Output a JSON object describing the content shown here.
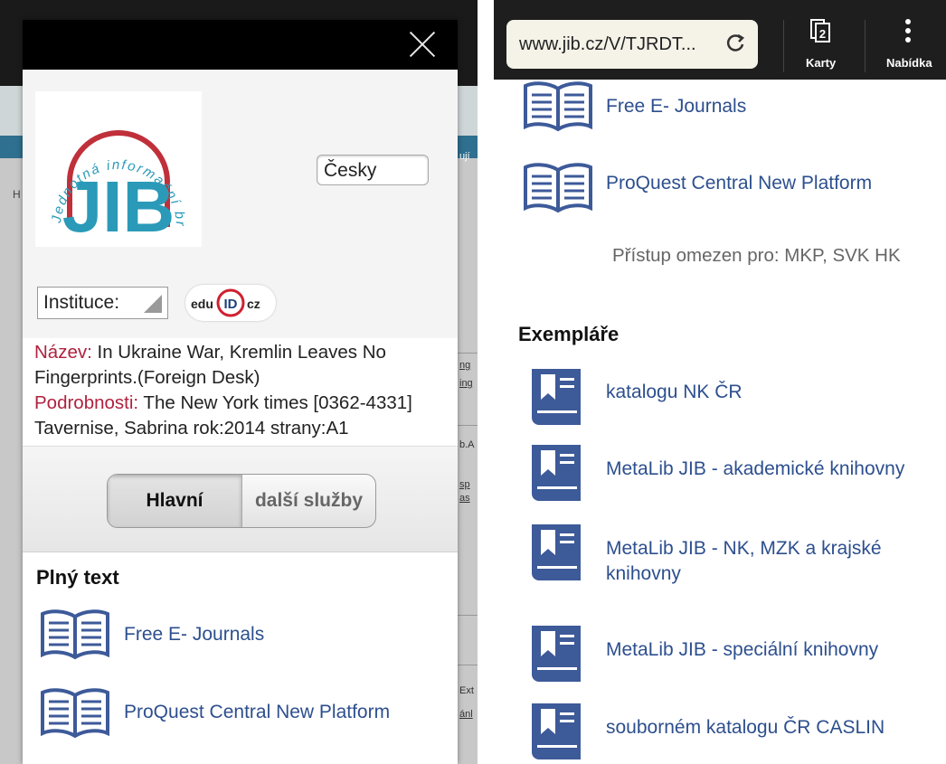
{
  "modal": {
    "logo_text": "JIB",
    "logo_arc_text": "Jednotná informační brána",
    "language_value": "Česky",
    "institution_label": "Instituce:",
    "eduid_logo": "eduID.cz",
    "record": {
      "title_label": "Název:",
      "title_value": " In Ukraine War, Kremlin Leaves No Fingerprints.(Foreign Desk)",
      "details_label": "Podrobnosti:",
      "details_value": " The New York times [0362-4331] Tavernise, Sabrina rok:2014 strany:A1"
    },
    "tabs": [
      {
        "label": "Hlavní",
        "active": true
      },
      {
        "label": "další služby",
        "active": false
      }
    ],
    "fulltext_heading": "Plný text",
    "fulltext_items": [
      "Free E- Journals",
      "ProQuest Central New Platform"
    ]
  },
  "browser": {
    "url": "www.jib.cz/V/TJRDT...",
    "tabs_count": "2",
    "tabs_label": "Karty",
    "menu_label": "Nabídka"
  },
  "right": {
    "fulltext_items": [
      "Free E- Journals",
      "ProQuest Central New Platform"
    ],
    "restriction_text": "Přístup omezen pro: MKP, SVK HK",
    "holdings_heading": "Exempláře",
    "holdings_items": [
      "katalogu NK ČR",
      "MetaLib JIB - akademické knihovny",
      "MetaLib JIB - NK, MZK a krajské knihovny",
      "MetaLib JIB - speciální knihovny",
      "souborném katalogu ČR CASLIN"
    ]
  },
  "background_page_fragments": [
    "ují",
    "ng",
    "ing",
    "b.A",
    "sp",
    "as",
    "Ext",
    "ánl",
    "H"
  ],
  "colors": {
    "link": "#2d4f8e",
    "label_red": "#b0213e",
    "book_blue": "#3d5a99",
    "logo_teal": "#2a9ab8"
  },
  "icons": {
    "book_open": "open-book-icon",
    "book_closed": "bookmark-book-icon",
    "close": "close-icon",
    "tabs": "tabs-icon",
    "menu": "overflow-menu-icon",
    "reload": "reload-icon"
  }
}
